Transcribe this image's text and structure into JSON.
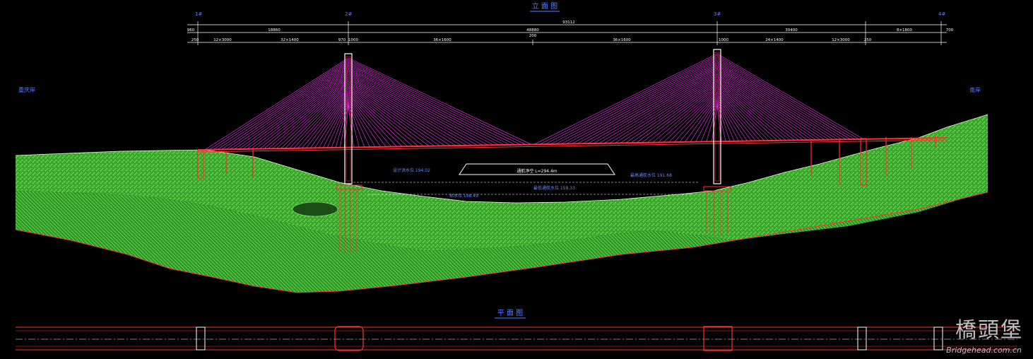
{
  "titles": {
    "elevation": "立 面 图",
    "plan": "平 面 图"
  },
  "banks": {
    "left": "重庆岸",
    "right": "南岸"
  },
  "dimensions": {
    "total": "93112",
    "spans": [
      "18860",
      "48880",
      "30400"
    ],
    "left_end": "960",
    "right_end": "700",
    "sub_left": [
      "250",
      "12×3000",
      "32×1400",
      "970",
      "1000"
    ],
    "sub_mid": [
      "36×1600",
      "200",
      "36×1600"
    ],
    "sub_right": [
      "1000",
      "24×1400",
      "12×3000",
      "250"
    ],
    "right_tail": "8×1800"
  },
  "water_levels": {
    "design_flood": "设计洪水位 194.02",
    "navigation_high": "最高通航水位 191.68",
    "navigable_clearance": "通航净空 L=294.4m",
    "navigation_low": "最低通航水位 159.33",
    "low_water": "枯水位 158.49"
  },
  "pier_labels": [
    "1#",
    "2#",
    "3#",
    "4#"
  ],
  "colors": {
    "cables": "#ff33ff",
    "ground_fill": "#3ca82c",
    "ground_hatch": "#7de85f",
    "structure": "#ff3030",
    "dims": "#ffffff",
    "labels": "#2a4cff"
  },
  "watermark": {
    "brand": "橋頭堡",
    "url": "Bridgehead.com.cn"
  }
}
